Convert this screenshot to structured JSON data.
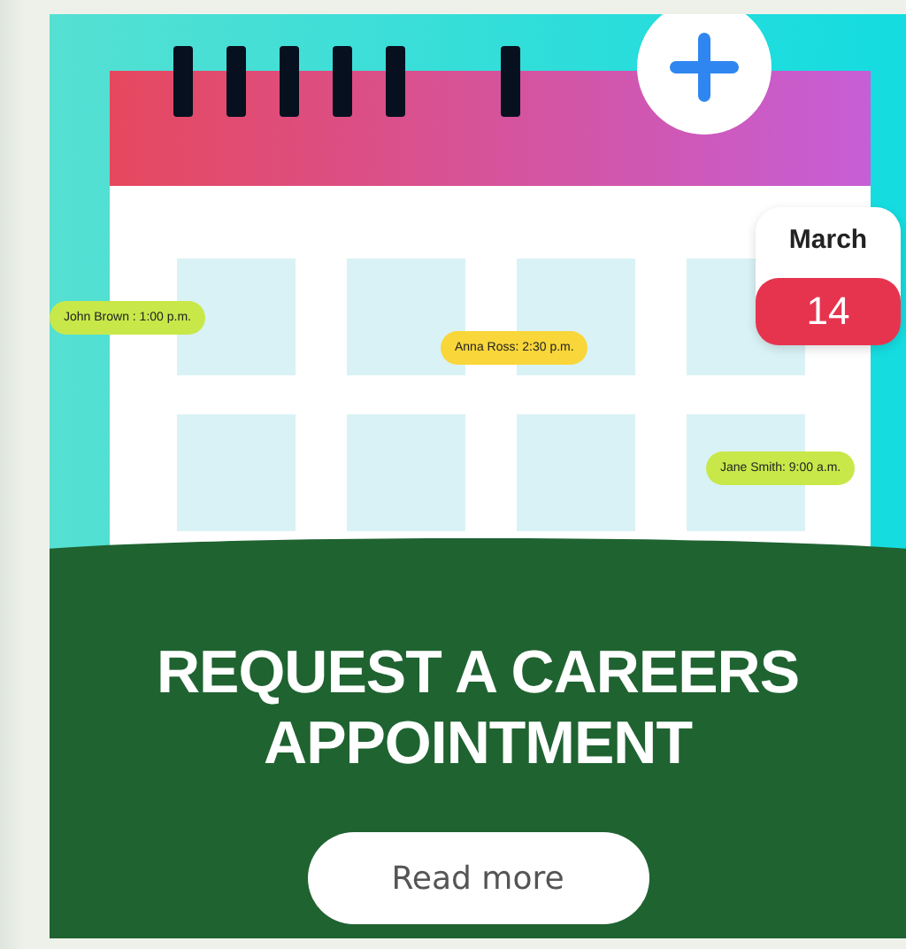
{
  "illustration": {
    "month_card": {
      "month": "March",
      "day": "14"
    },
    "appointments": [
      {
        "text": "John Brown : 1:00 p.m.",
        "color": "#c8e84a"
      },
      {
        "text": "Anna Ross: 2:30 p.m.",
        "color": "#f9d63a"
      },
      {
        "text": "Jane Smith: 9:00 a.m.",
        "color": "#c8e84a"
      }
    ]
  },
  "title": "REQUEST A CAREERS APPOINTMENT",
  "button": "Read more"
}
